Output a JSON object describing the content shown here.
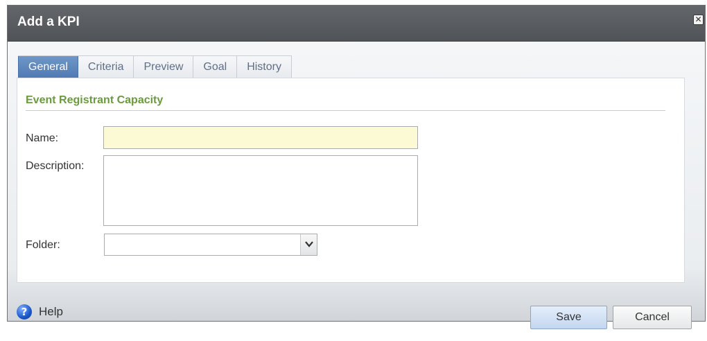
{
  "dialog": {
    "title": "Add a KPI",
    "close_icon": "close-icon"
  },
  "tabs": [
    {
      "label": "General",
      "active": true
    },
    {
      "label": "Criteria",
      "active": false
    },
    {
      "label": "Preview",
      "active": false
    },
    {
      "label": "Goal",
      "active": false
    },
    {
      "label": "History",
      "active": false
    }
  ],
  "form": {
    "section_title": "Event Registrant Capacity",
    "name_label": "Name:",
    "name_value": "",
    "description_label": "Description:",
    "description_value": "",
    "folder_label": "Folder:",
    "folder_value": ""
  },
  "footer": {
    "help_label": "Help",
    "help_icon": "question-circle-icon",
    "save_label": "Save",
    "cancel_label": "Cancel"
  },
  "colors": {
    "title_bar": "#575a5e",
    "active_tab": "#5f88bd",
    "section_title": "#6a9b3c",
    "name_field_bg": "#fbfad4"
  }
}
